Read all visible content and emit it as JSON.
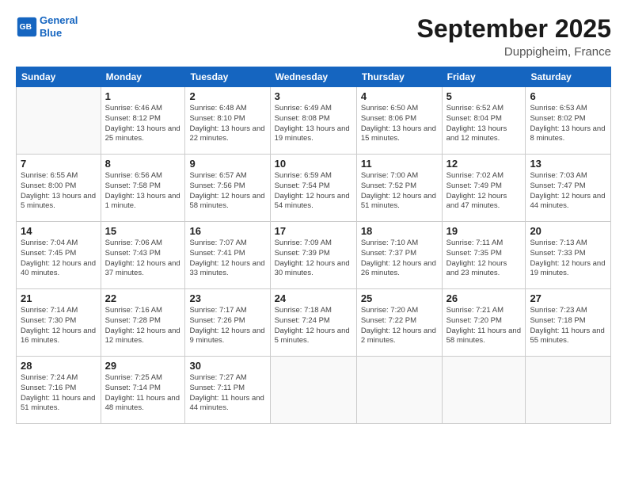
{
  "header": {
    "logo_line1": "General",
    "logo_line2": "Blue",
    "month_title": "September 2025",
    "location": "Duppigheim, France"
  },
  "days_of_week": [
    "Sunday",
    "Monday",
    "Tuesday",
    "Wednesday",
    "Thursday",
    "Friday",
    "Saturday"
  ],
  "weeks": [
    [
      {
        "day": "",
        "info": ""
      },
      {
        "day": "1",
        "info": "Sunrise: 6:46 AM\nSunset: 8:12 PM\nDaylight: 13 hours\nand 25 minutes."
      },
      {
        "day": "2",
        "info": "Sunrise: 6:48 AM\nSunset: 8:10 PM\nDaylight: 13 hours\nand 22 minutes."
      },
      {
        "day": "3",
        "info": "Sunrise: 6:49 AM\nSunset: 8:08 PM\nDaylight: 13 hours\nand 19 minutes."
      },
      {
        "day": "4",
        "info": "Sunrise: 6:50 AM\nSunset: 8:06 PM\nDaylight: 13 hours\nand 15 minutes."
      },
      {
        "day": "5",
        "info": "Sunrise: 6:52 AM\nSunset: 8:04 PM\nDaylight: 13 hours\nand 12 minutes."
      },
      {
        "day": "6",
        "info": "Sunrise: 6:53 AM\nSunset: 8:02 PM\nDaylight: 13 hours\nand 8 minutes."
      }
    ],
    [
      {
        "day": "7",
        "info": "Sunrise: 6:55 AM\nSunset: 8:00 PM\nDaylight: 13 hours\nand 5 minutes."
      },
      {
        "day": "8",
        "info": "Sunrise: 6:56 AM\nSunset: 7:58 PM\nDaylight: 13 hours\nand 1 minute."
      },
      {
        "day": "9",
        "info": "Sunrise: 6:57 AM\nSunset: 7:56 PM\nDaylight: 12 hours\nand 58 minutes."
      },
      {
        "day": "10",
        "info": "Sunrise: 6:59 AM\nSunset: 7:54 PM\nDaylight: 12 hours\nand 54 minutes."
      },
      {
        "day": "11",
        "info": "Sunrise: 7:00 AM\nSunset: 7:52 PM\nDaylight: 12 hours\nand 51 minutes."
      },
      {
        "day": "12",
        "info": "Sunrise: 7:02 AM\nSunset: 7:49 PM\nDaylight: 12 hours\nand 47 minutes."
      },
      {
        "day": "13",
        "info": "Sunrise: 7:03 AM\nSunset: 7:47 PM\nDaylight: 12 hours\nand 44 minutes."
      }
    ],
    [
      {
        "day": "14",
        "info": "Sunrise: 7:04 AM\nSunset: 7:45 PM\nDaylight: 12 hours\nand 40 minutes."
      },
      {
        "day": "15",
        "info": "Sunrise: 7:06 AM\nSunset: 7:43 PM\nDaylight: 12 hours\nand 37 minutes."
      },
      {
        "day": "16",
        "info": "Sunrise: 7:07 AM\nSunset: 7:41 PM\nDaylight: 12 hours\nand 33 minutes."
      },
      {
        "day": "17",
        "info": "Sunrise: 7:09 AM\nSunset: 7:39 PM\nDaylight: 12 hours\nand 30 minutes."
      },
      {
        "day": "18",
        "info": "Sunrise: 7:10 AM\nSunset: 7:37 PM\nDaylight: 12 hours\nand 26 minutes."
      },
      {
        "day": "19",
        "info": "Sunrise: 7:11 AM\nSunset: 7:35 PM\nDaylight: 12 hours\nand 23 minutes."
      },
      {
        "day": "20",
        "info": "Sunrise: 7:13 AM\nSunset: 7:33 PM\nDaylight: 12 hours\nand 19 minutes."
      }
    ],
    [
      {
        "day": "21",
        "info": "Sunrise: 7:14 AM\nSunset: 7:30 PM\nDaylight: 12 hours\nand 16 minutes."
      },
      {
        "day": "22",
        "info": "Sunrise: 7:16 AM\nSunset: 7:28 PM\nDaylight: 12 hours\nand 12 minutes."
      },
      {
        "day": "23",
        "info": "Sunrise: 7:17 AM\nSunset: 7:26 PM\nDaylight: 12 hours\nand 9 minutes."
      },
      {
        "day": "24",
        "info": "Sunrise: 7:18 AM\nSunset: 7:24 PM\nDaylight: 12 hours\nand 5 minutes."
      },
      {
        "day": "25",
        "info": "Sunrise: 7:20 AM\nSunset: 7:22 PM\nDaylight: 12 hours\nand 2 minutes."
      },
      {
        "day": "26",
        "info": "Sunrise: 7:21 AM\nSunset: 7:20 PM\nDaylight: 11 hours\nand 58 minutes."
      },
      {
        "day": "27",
        "info": "Sunrise: 7:23 AM\nSunset: 7:18 PM\nDaylight: 11 hours\nand 55 minutes."
      }
    ],
    [
      {
        "day": "28",
        "info": "Sunrise: 7:24 AM\nSunset: 7:16 PM\nDaylight: 11 hours\nand 51 minutes."
      },
      {
        "day": "29",
        "info": "Sunrise: 7:25 AM\nSunset: 7:14 PM\nDaylight: 11 hours\nand 48 minutes."
      },
      {
        "day": "30",
        "info": "Sunrise: 7:27 AM\nSunset: 7:11 PM\nDaylight: 11 hours\nand 44 minutes."
      },
      {
        "day": "",
        "info": ""
      },
      {
        "day": "",
        "info": ""
      },
      {
        "day": "",
        "info": ""
      },
      {
        "day": "",
        "info": ""
      }
    ]
  ]
}
